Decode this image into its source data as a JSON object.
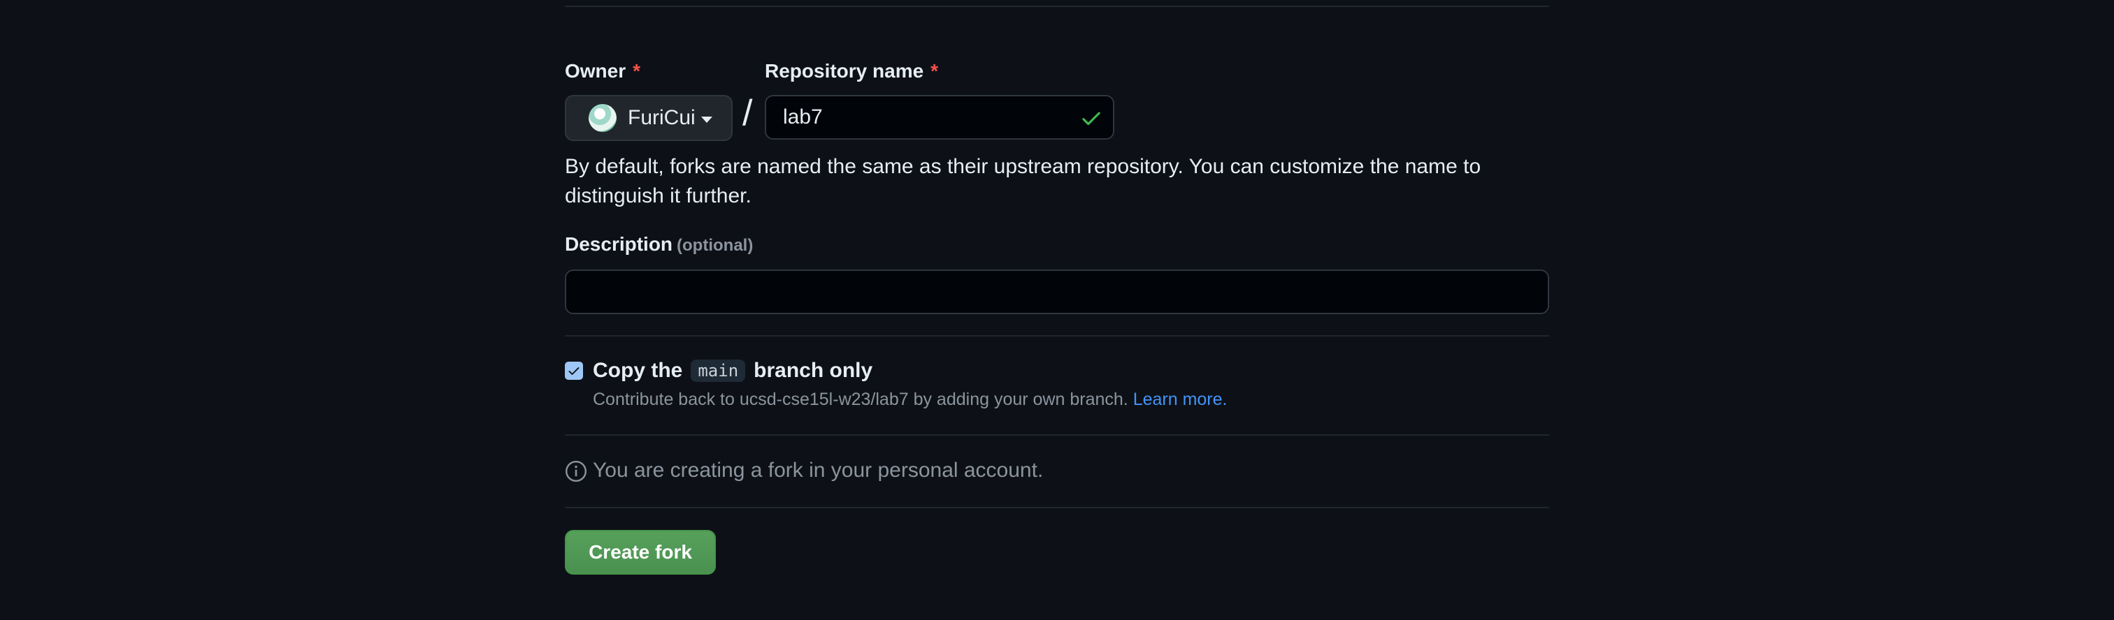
{
  "owner": {
    "label": "Owner",
    "required_mark": "*",
    "selected": "FuriCui"
  },
  "separator": "/",
  "repository": {
    "label": "Repository name",
    "required_mark": "*",
    "value": "lab7",
    "status": "valid"
  },
  "help_text": "By default, forks are named the same as their upstream repository. You can customize the name to distinguish it further.",
  "description": {
    "label": "Description",
    "optional_label": "(optional)",
    "value": "",
    "placeholder": ""
  },
  "copy_branch": {
    "checked": true,
    "label_prefix": "Copy the",
    "branch": "main",
    "label_suffix": "branch only",
    "subtext": "Contribute back to ucsd-cse15l-w23/lab7 by adding your own branch.",
    "link": "Learn more."
  },
  "notice": "You are creating a fork in your personal account.",
  "submit_label": "Create fork",
  "colors": {
    "background": "#0d1117",
    "required": "#f85149",
    "link": "#4493f8",
    "primary_button": "#4a9150",
    "check": "#3fb950"
  },
  "icons": {
    "check": "check-icon",
    "info": "info-icon",
    "caret": "caret-down-icon"
  }
}
